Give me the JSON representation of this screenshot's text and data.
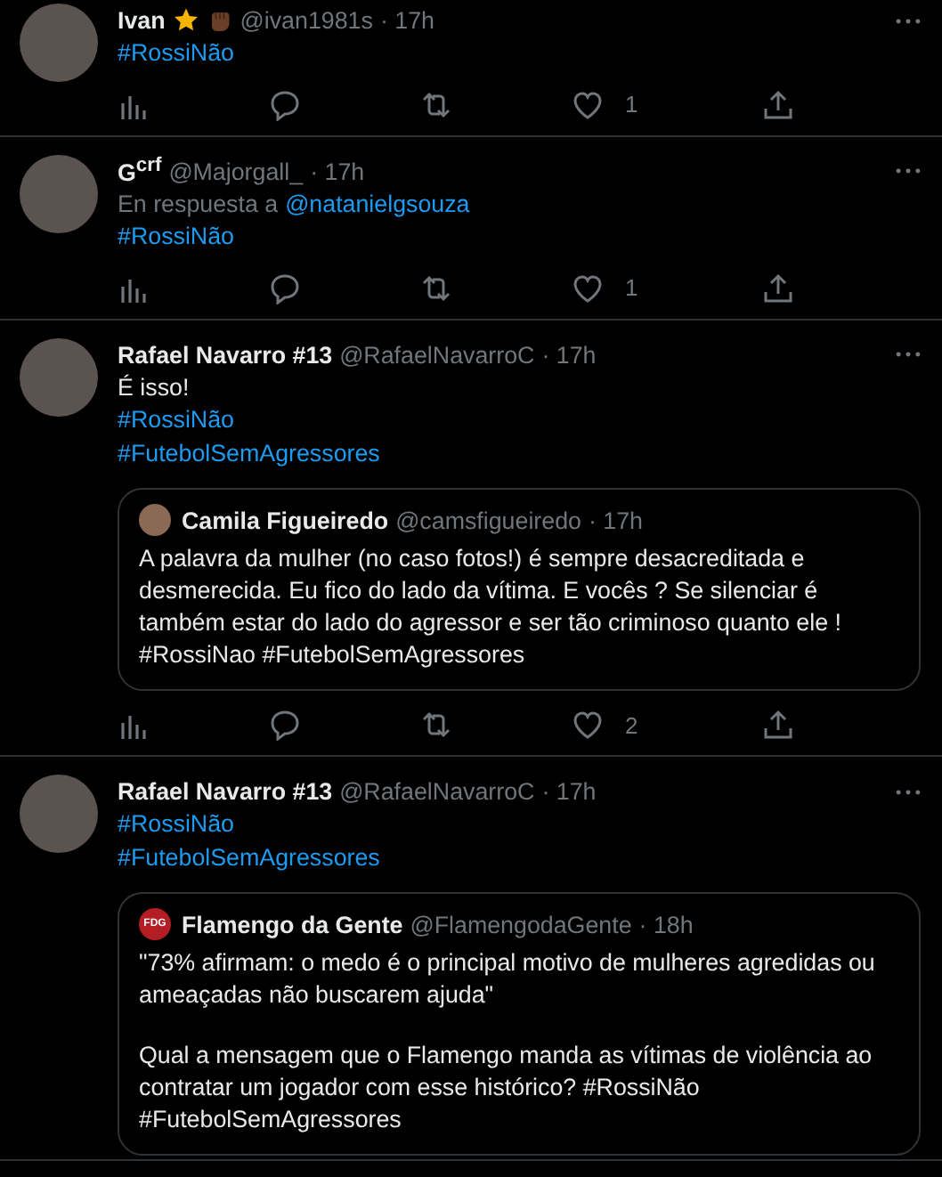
{
  "tweets": [
    {
      "name": "Ivan",
      "badges": [
        {
          "kind": "star"
        },
        {
          "kind": "fist"
        }
      ],
      "handle": "@ivan1981s",
      "time": "· 17h",
      "lines": [
        {
          "kind": "hashtag",
          "text": "#RossiNão"
        }
      ],
      "likes": "1"
    },
    {
      "name": "G$^{crf}$",
      "handle": "@Majorgall_",
      "time": "· 17h",
      "reply_to": {
        "label": "En respuesta a",
        "handle": "@natanielgsouza"
      },
      "lines": [
        {
          "kind": "hashtag",
          "text": "#RossiNão"
        }
      ],
      "likes": "1"
    },
    {
      "name": "Rafael Navarro #13",
      "handle": "@RafaelNavarroC",
      "time": "· 17h",
      "lines": [
        {
          "kind": "text",
          "text": "É isso!"
        },
        {
          "kind": "hashtag",
          "text": "#RossiNão"
        },
        {
          "kind": "hashtag",
          "text": "#FutebolSemAgressores"
        }
      ],
      "quote": {
        "name": "Camila Figueiredo",
        "handle": "@camsfigueiredo",
        "time": "· 17h",
        "paragraphs": [
          "A palavra da mulher (no caso fotos!) é sempre desacreditada e desmerecida. Eu fico do lado da vítima. E vocês ? Se silenciar é também estar do lado do agressor e ser tão criminoso quanto ele ! #RossiNao #FutebolSemAgressores"
        ]
      },
      "likes": "2"
    },
    {
      "name": "Rafael Navarro #13",
      "handle": "@RafaelNavarroC",
      "time": "· 17h",
      "lines": [
        {
          "kind": "hashtag",
          "text": "#RossiNão"
        },
        {
          "kind": "hashtag",
          "text": "#FutebolSemAgressores"
        }
      ],
      "quote": {
        "name": "Flamengo da Gente",
        "handle": "@FlamengodaGente",
        "time": "· 18h",
        "avatar_text": "FDG",
        "paragraphs": [
          "\"73% afirmam: o medo é o principal motivo de mulheres agredidas ou ameaçadas não buscarem ajuda\"",
          "Qual a mensagem que o Flamengo manda as vítimas de violência ao contratar um jogador com esse histórico? #RossiNão #FutebolSemAgressores"
        ]
      }
    }
  ]
}
